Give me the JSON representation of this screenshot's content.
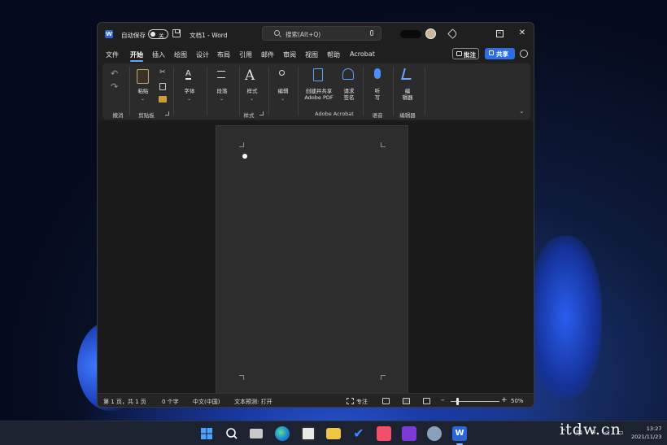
{
  "titlebar": {
    "autosave_label": "自动保存",
    "autosave_state": "关",
    "doc_title": "文档1  -  Word",
    "search_placeholder": "搜索(Alt+Q)"
  },
  "menu": {
    "items": [
      "文件",
      "开始",
      "插入",
      "绘图",
      "设计",
      "布局",
      "引用",
      "邮件",
      "审阅",
      "视图",
      "帮助",
      "Acrobat"
    ],
    "active": "开始",
    "comment_label": "批注",
    "share_label": "共享"
  },
  "ribbon": {
    "groups": {
      "undo": "撤消",
      "clipboard": "剪贴板",
      "styles": "样式",
      "adobe": "Adobe Acrobat",
      "voice": "语音",
      "editor": "编辑器"
    },
    "buttons": {
      "paste": "粘贴",
      "font": "字体",
      "paragraph": "段落",
      "styles": "样式",
      "editing": "编辑",
      "create_share_1": "创建并共享",
      "create_share_2": "Adobe PDF",
      "request_sign_1": "请求",
      "request_sign_2": "签名",
      "dictate_1": "听",
      "dictate_2": "写",
      "editor_1": "编",
      "editor_2": "辑器"
    }
  },
  "status": {
    "page": "第 1 页，共 1 页",
    "words": "0 个字",
    "language": "中文(中国)",
    "predictions": "文本预测: 打开",
    "focus": "专注",
    "zoom": "50%",
    "zoom_level_fraction": 0.12
  },
  "taskbar": {
    "tray_caret": "^",
    "ime": "中",
    "time": "13:27",
    "date": "2021/11/23"
  },
  "watermark": "itdw.cn",
  "colors": {
    "accent": "#2f6ee0",
    "word_blue": "#2b66d9",
    "ribbon_bg": "#2b2b2b",
    "page_bg": "#2d2d2d"
  }
}
